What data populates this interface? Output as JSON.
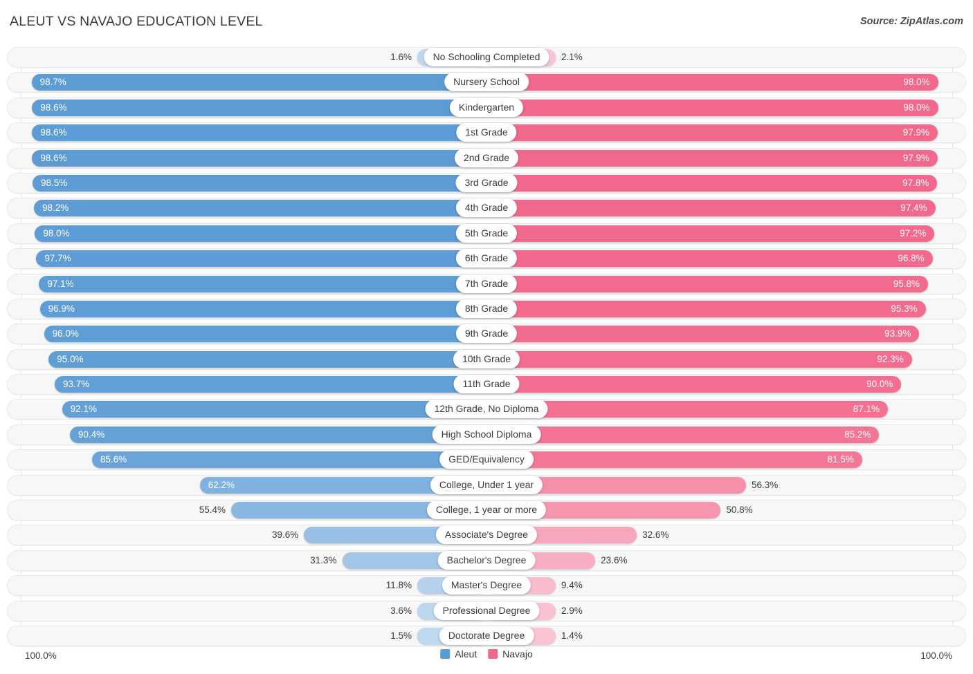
{
  "header": {
    "title": "ALEUT VS NAVAJO EDUCATION LEVEL",
    "source": "Source: ZipAtlas.com"
  },
  "axis": {
    "min_label": "100.0%",
    "max_label": "100.0%"
  },
  "legend": {
    "items": [
      {
        "label": "Aleut",
        "color": "#5b9bd5"
      },
      {
        "label": "Navajo",
        "color": "#f2668b"
      }
    ]
  },
  "colors": {
    "aleut": "#5b9bd5",
    "navajo": "#f2668b",
    "aleut_light": "#9dc3e6",
    "navajo_light": "#f4a0bd",
    "track": "#f7f7f7",
    "gridline": "#e3e3e3"
  },
  "chart_data": {
    "type": "bar",
    "title": "ALEUT VS NAVAJO EDUCATION LEVEL",
    "subtitle": "",
    "xlabel": "",
    "ylabel": "",
    "orientation": "horizontal-diverging",
    "xlim": [
      0,
      100
    ],
    "grid": true,
    "legend_position": "bottom-center",
    "categories": [
      "No Schooling Completed",
      "Nursery School",
      "Kindergarten",
      "1st Grade",
      "2nd Grade",
      "3rd Grade",
      "4th Grade",
      "5th Grade",
      "6th Grade",
      "7th Grade",
      "8th Grade",
      "9th Grade",
      "10th Grade",
      "11th Grade",
      "12th Grade, No Diploma",
      "High School Diploma",
      "GED/Equivalency",
      "College, Under 1 year",
      "College, 1 year or more",
      "Associate's Degree",
      "Bachelor's Degree",
      "Master's Degree",
      "Professional Degree",
      "Doctorate Degree"
    ],
    "series": [
      {
        "name": "Aleut",
        "color": "#5b9bd5",
        "values": [
          1.6,
          98.7,
          98.6,
          98.6,
          98.6,
          98.5,
          98.2,
          98.0,
          97.7,
          97.1,
          96.9,
          96.0,
          95.0,
          93.7,
          92.1,
          90.4,
          85.6,
          62.2,
          55.4,
          39.6,
          31.3,
          11.8,
          3.6,
          1.5
        ],
        "labels": [
          "1.6%",
          "98.7%",
          "98.6%",
          "98.6%",
          "98.6%",
          "98.5%",
          "98.2%",
          "98.0%",
          "97.7%",
          "97.1%",
          "96.9%",
          "96.0%",
          "95.0%",
          "93.7%",
          "92.1%",
          "90.4%",
          "85.6%",
          "62.2%",
          "55.4%",
          "39.6%",
          "31.3%",
          "11.8%",
          "3.6%",
          "1.5%"
        ]
      },
      {
        "name": "Navajo",
        "color": "#f2668b",
        "values": [
          2.1,
          98.0,
          98.0,
          97.9,
          97.9,
          97.8,
          97.4,
          97.2,
          96.8,
          95.8,
          95.3,
          93.9,
          92.3,
          90.0,
          87.1,
          85.2,
          81.5,
          56.3,
          50.8,
          32.6,
          23.6,
          9.4,
          2.9,
          1.4
        ],
        "labels": [
          "2.1%",
          "98.0%",
          "98.0%",
          "97.9%",
          "97.9%",
          "97.8%",
          "97.4%",
          "97.2%",
          "96.8%",
          "95.8%",
          "95.3%",
          "93.9%",
          "92.3%",
          "90.0%",
          "87.1%",
          "85.2%",
          "81.5%",
          "56.3%",
          "50.8%",
          "32.6%",
          "23.6%",
          "9.4%",
          "2.9%",
          "1.4%"
        ]
      }
    ]
  }
}
